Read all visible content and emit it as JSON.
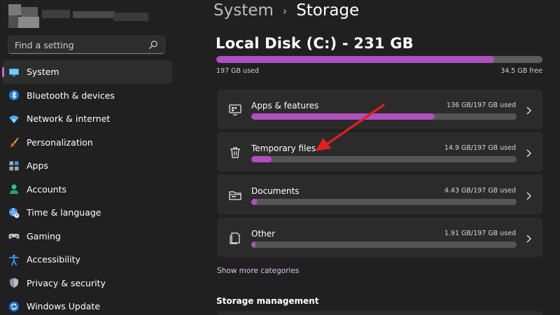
{
  "sidebar": {
    "search_placeholder": "Find a setting",
    "items": [
      {
        "label": "System",
        "icon": "monitor-icon",
        "active": true
      },
      {
        "label": "Bluetooth & devices",
        "icon": "bluetooth-icon"
      },
      {
        "label": "Network & internet",
        "icon": "wifi-icon"
      },
      {
        "label": "Personalization",
        "icon": "brush-icon"
      },
      {
        "label": "Apps",
        "icon": "apps-icon"
      },
      {
        "label": "Accounts",
        "icon": "person-icon"
      },
      {
        "label": "Time & language",
        "icon": "globe-clock-icon"
      },
      {
        "label": "Gaming",
        "icon": "gamepad-icon"
      },
      {
        "label": "Accessibility",
        "icon": "accessibility-icon"
      },
      {
        "label": "Privacy & security",
        "icon": "shield-icon"
      },
      {
        "label": "Windows Update",
        "icon": "update-icon"
      }
    ]
  },
  "breadcrumb": {
    "parent": "System",
    "separator": "›",
    "current": "Storage"
  },
  "disk": {
    "title": "Local Disk (C:) - 231 GB",
    "used_label": "197 GB used",
    "free_label": "34.5 GB free",
    "used_fraction": 0.853
  },
  "categories": [
    {
      "name": "Apps & features",
      "usage": "136 GB/197 GB used",
      "fraction": 0.69,
      "icon": "apps-features-icon"
    },
    {
      "name": "Temporary files",
      "usage": "14.9 GB/197 GB used",
      "fraction": 0.076,
      "icon": "trash-icon"
    },
    {
      "name": "Documents",
      "usage": "4.43 GB/197 GB used",
      "fraction": 0.022,
      "icon": "folder-icon"
    },
    {
      "name": "Other",
      "usage": "1.91 GB/197 GB used",
      "fraction": 0.01,
      "icon": "document-icon"
    }
  ],
  "show_more_label": "Show more categories",
  "storage_management_title": "Storage management",
  "colors": {
    "accent": "#b04fbf",
    "background": "#202020",
    "card": "#2b2b2b",
    "annotation_arrow": "#e02020"
  }
}
